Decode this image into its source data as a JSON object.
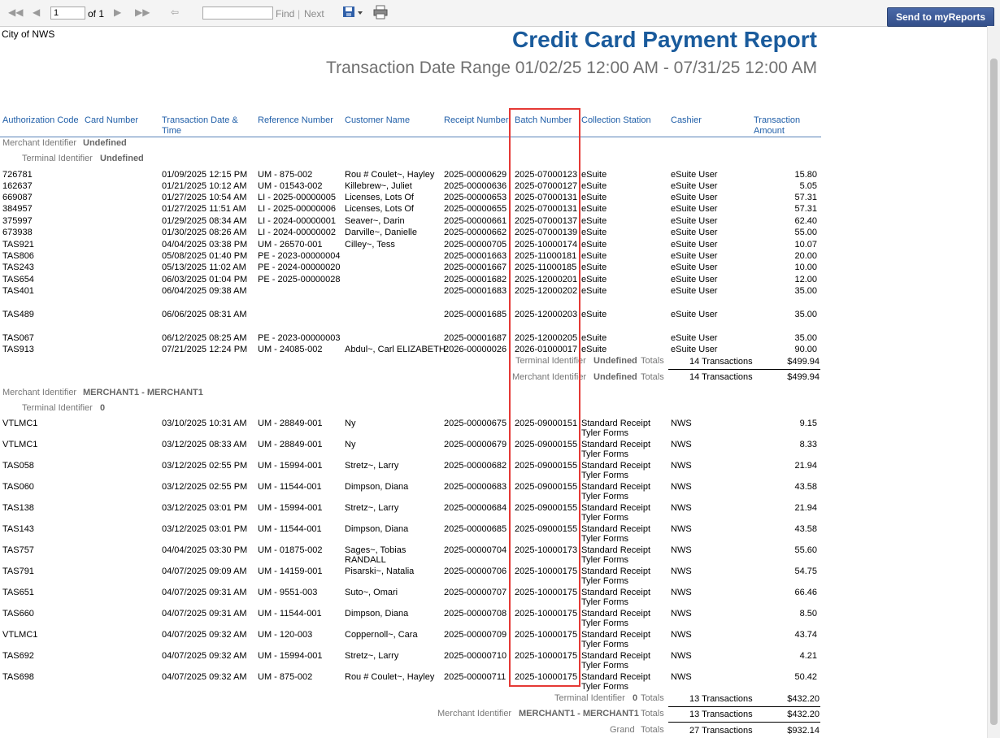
{
  "toolbar": {
    "first_icon": "first-page-icon",
    "prev_icon": "previous-page-icon",
    "page_value": "1",
    "of_label": "of 1",
    "next_icon": "next-page-icon",
    "last_icon": "last-page-icon",
    "back_icon": "back-icon",
    "find_value": "",
    "find_label": "Find",
    "separator": "|",
    "next_label": "Next",
    "export_icon": "save-export-icon",
    "print_icon": "printer-icon",
    "send_button": "Send to myReports"
  },
  "report": {
    "logo_alt": "City of NWS",
    "title": "Credit Card Payment Report",
    "subtitle": "Transaction Date Range 01/02/25 12:00 AM - 07/31/25 12:00 AM"
  },
  "headers": {
    "auth": "Authorization Code",
    "card": "Card Number",
    "date_l1": "Transaction Date &",
    "date_l2": "Time",
    "ref": "Reference Number",
    "customer": "Customer Name",
    "receipt": "Receipt Number",
    "batch": "Batch Number",
    "station": "Collection Station",
    "cashier": "Cashier",
    "amount_l1": "Transaction",
    "amount_l2": "Amount"
  },
  "labels": {
    "merchant_identifier": "Merchant Identifier",
    "terminal_identifier": "Terminal Identifier",
    "totals": "Totals",
    "grand": "Grand"
  },
  "groups": [
    {
      "merchant": "Undefined",
      "terminal": "Undefined",
      "rows": [
        {
          "auth": "726781",
          "date": "01/09/2025 12:15 PM",
          "ref": "UM - 875-002",
          "customer": "Rou # Coulet~, Hayley",
          "receipt": "2025-00000629",
          "batch": "2025-07000123",
          "station": "eSuite",
          "station2": "",
          "cashier": "eSuite User",
          "amount": "15.80",
          "customer2": ""
        },
        {
          "auth": "162637",
          "date": "01/21/2025 10:12 AM",
          "ref": "UM - 01543-002",
          "customer": "Killebrew~, Juliet",
          "receipt": "2025-00000636",
          "batch": "2025-07000127",
          "station": "eSuite",
          "station2": "",
          "cashier": "eSuite User",
          "amount": "5.05",
          "customer2": ""
        },
        {
          "auth": "669087",
          "date": "01/27/2025 10:54 AM",
          "ref": "LI - 2025-00000005",
          "customer": "Licenses, Lots Of",
          "receipt": "2025-00000653",
          "batch": "2025-07000131",
          "station": "eSuite",
          "station2": "",
          "cashier": "eSuite User",
          "amount": "57.31",
          "customer2": ""
        },
        {
          "auth": "384957",
          "date": "01/27/2025 11:51 AM",
          "ref": "LI - 2025-00000006",
          "customer": "Licenses, Lots Of",
          "receipt": "2025-00000655",
          "batch": "2025-07000131",
          "station": "eSuite",
          "station2": "",
          "cashier": "eSuite User",
          "amount": "57.31",
          "customer2": ""
        },
        {
          "auth": "375997",
          "date": "01/29/2025 08:34 AM",
          "ref": "LI - 2024-00000001",
          "customer": "Seaver~, Darin",
          "receipt": "2025-00000661",
          "batch": "2025-07000137",
          "station": "eSuite",
          "station2": "",
          "cashier": "eSuite User",
          "amount": "62.40",
          "customer2": ""
        },
        {
          "auth": "673938",
          "date": "01/30/2025 08:26 AM",
          "ref": "LI - 2024-00000002",
          "customer": "Darville~, Danielle",
          "receipt": "2025-00000662",
          "batch": "2025-07000139",
          "station": "eSuite",
          "station2": "",
          "cashier": "eSuite User",
          "amount": "55.00",
          "customer2": ""
        },
        {
          "auth": "TAS921",
          "date": "04/04/2025 03:38 PM",
          "ref": "UM - 26570-001",
          "customer": "Cilley~, Tess",
          "receipt": "2025-00000705",
          "batch": "2025-10000174",
          "station": "eSuite",
          "station2": "",
          "cashier": "eSuite User",
          "amount": "10.07",
          "customer2": ""
        },
        {
          "auth": "TAS806",
          "date": "05/08/2025 01:40 PM",
          "ref": "PE - 2023-00000004",
          "customer": "",
          "receipt": "2025-00001663",
          "batch": "2025-11000181",
          "station": "eSuite",
          "station2": "",
          "cashier": "eSuite User",
          "amount": "20.00",
          "customer2": ""
        },
        {
          "auth": "TAS243",
          "date": "05/13/2025 11:02 AM",
          "ref": "PE - 2024-00000020",
          "customer": "",
          "receipt": "2025-00001667",
          "batch": "2025-11000185",
          "station": "eSuite",
          "station2": "",
          "cashier": "eSuite User",
          "amount": "10.00",
          "customer2": ""
        },
        {
          "auth": "TAS654",
          "date": "06/03/2025 01:04 PM",
          "ref": "PE - 2025-00000028",
          "customer": "",
          "receipt": "2025-00001682",
          "batch": "2025-12000201",
          "station": "eSuite",
          "station2": "",
          "cashier": "eSuite User",
          "amount": "12.00",
          "customer2": ""
        },
        {
          "auth": "TAS401",
          "date": "06/04/2025 09:38 AM",
          "ref": "",
          "customer": "",
          "receipt": "2025-00001683",
          "batch": "2025-12000202",
          "station": "eSuite",
          "station2": "",
          "cashier": "eSuite User",
          "amount": "35.00",
          "customer2": ""
        },
        {
          "auth": "TAS489",
          "date": "06/06/2025 08:31 AM",
          "ref": "",
          "customer": "",
          "receipt": "2025-00001685",
          "batch": "2025-12000203",
          "station": "eSuite",
          "station2": "",
          "cashier": "eSuite User",
          "amount": "35.00",
          "customer2": ""
        },
        {
          "auth": "TAS067",
          "date": "06/12/2025 08:25 AM",
          "ref": "PE - 2023-00000003",
          "customer": "",
          "receipt": "2025-00001687",
          "batch": "2025-12000205",
          "station": "eSuite",
          "station2": "",
          "cashier": "eSuite User",
          "amount": "35.00",
          "customer2": ""
        },
        {
          "auth": "TAS913",
          "date": "07/21/2025 12:24 PM",
          "ref": "UM - 24085-002",
          "customer": "Abdul~, Carl ELIZABETH",
          "receipt": "2026-00000026",
          "batch": "2026-01000017",
          "station": "eSuite",
          "station2": "",
          "cashier": "eSuite User",
          "amount": "90.00",
          "customer2": ""
        }
      ],
      "terminal_total_count": "14 Transactions",
      "terminal_total_amount": "$499.94",
      "merchant_total_count": "14 Transactions",
      "merchant_total_amount": "$499.94"
    },
    {
      "merchant": "MERCHANT1 - MERCHANT1",
      "terminal": "0",
      "rows": [
        {
          "auth": "VTLMC1",
          "date": "03/10/2025 10:31 AM",
          "ref": "UM - 28849-001",
          "customer": "Ny",
          "receipt": "2025-00000675",
          "batch": "2025-09000151",
          "station": "Standard Receipt",
          "station2": "Tyler Forms",
          "cashier": "NWS",
          "amount": "9.15",
          "customer2": ""
        },
        {
          "auth": "VTLMC1",
          "date": "03/12/2025 08:33 AM",
          "ref": "UM - 28849-001",
          "customer": "Ny",
          "receipt": "2025-00000679",
          "batch": "2025-09000155",
          "station": "Standard Receipt",
          "station2": "Tyler Forms",
          "cashier": "NWS",
          "amount": "8.33",
          "customer2": ""
        },
        {
          "auth": "TAS058",
          "date": "03/12/2025 02:55 PM",
          "ref": "UM - 15994-001",
          "customer": "Stretz~, Larry",
          "receipt": "2025-00000682",
          "batch": "2025-09000155",
          "station": "Standard Receipt",
          "station2": "Tyler Forms",
          "cashier": "NWS",
          "amount": "21.94",
          "customer2": ""
        },
        {
          "auth": "TAS060",
          "date": "03/12/2025 02:55 PM",
          "ref": "UM - 11544-001",
          "customer": "Dimpson, Diana",
          "receipt": "2025-00000683",
          "batch": "2025-09000155",
          "station": "Standard Receipt",
          "station2": "Tyler Forms",
          "cashier": "NWS",
          "amount": "43.58",
          "customer2": ""
        },
        {
          "auth": "TAS138",
          "date": "03/12/2025 03:01 PM",
          "ref": "UM - 15994-001",
          "customer": "Stretz~, Larry",
          "receipt": "2025-00000684",
          "batch": "2025-09000155",
          "station": "Standard Receipt",
          "station2": "Tyler Forms",
          "cashier": "NWS",
          "amount": "21.94",
          "customer2": ""
        },
        {
          "auth": "TAS143",
          "date": "03/12/2025 03:01 PM",
          "ref": "UM - 11544-001",
          "customer": "Dimpson, Diana",
          "receipt": "2025-00000685",
          "batch": "2025-09000155",
          "station": "Standard Receipt",
          "station2": "Tyler Forms",
          "cashier": "NWS",
          "amount": "43.58",
          "customer2": ""
        },
        {
          "auth": "TAS757",
          "date": "04/04/2025 03:30 PM",
          "ref": "UM - 01875-002",
          "customer": "Sages~, Tobias",
          "receipt": "2025-00000704",
          "batch": "2025-10000173",
          "station": "Standard Receipt",
          "station2": "Tyler Forms",
          "cashier": "NWS",
          "amount": "55.60",
          "customer2": "RANDALL"
        },
        {
          "auth": "TAS791",
          "date": "04/07/2025 09:09 AM",
          "ref": "UM - 14159-001",
          "customer": "Pisarski~, Natalia",
          "receipt": "2025-00000706",
          "batch": "2025-10000175",
          "station": "Standard Receipt",
          "station2": "Tyler Forms",
          "cashier": "NWS",
          "amount": "54.75",
          "customer2": ""
        },
        {
          "auth": "TAS651",
          "date": "04/07/2025 09:31 AM",
          "ref": "UM - 9551-003",
          "customer": "Suto~, Omari",
          "receipt": "2025-00000707",
          "batch": "2025-10000175",
          "station": "Standard Receipt",
          "station2": "Tyler Forms",
          "cashier": "NWS",
          "amount": "66.46",
          "customer2": ""
        },
        {
          "auth": "TAS660",
          "date": "04/07/2025 09:31 AM",
          "ref": "UM - 11544-001",
          "customer": "Dimpson, Diana",
          "receipt": "2025-00000708",
          "batch": "2025-10000175",
          "station": "Standard Receipt",
          "station2": "Tyler Forms",
          "cashier": "NWS",
          "amount": "8.50",
          "customer2": ""
        },
        {
          "auth": "VTLMC1",
          "date": "04/07/2025 09:32 AM",
          "ref": "UM - 120-003",
          "customer": "Coppernoll~, Cara",
          "receipt": "2025-00000709",
          "batch": "2025-10000175",
          "station": "Standard Receipt",
          "station2": "Tyler Forms",
          "cashier": "NWS",
          "amount": "43.74",
          "customer2": ""
        },
        {
          "auth": "TAS692",
          "date": "04/07/2025 09:32 AM",
          "ref": "UM - 15994-001",
          "customer": "Stretz~, Larry",
          "receipt": "2025-00000710",
          "batch": "2025-10000175",
          "station": "Standard Receipt",
          "station2": "Tyler Forms",
          "cashier": "NWS",
          "amount": "4.21",
          "customer2": ""
        },
        {
          "auth": "TAS698",
          "date": "04/07/2025 09:32 AM",
          "ref": "UM - 875-002",
          "customer": "Rou # Coulet~, Hayley",
          "receipt": "2025-00000711",
          "batch": "2025-10000175",
          "station": "Standard Receipt",
          "station2": "Tyler Forms",
          "cashier": "NWS",
          "amount": "50.42",
          "customer2": ""
        }
      ],
      "terminal_total_count": "13 Transactions",
      "terminal_total_amount": "$432.20",
      "merchant_total_count": "13 Transactions",
      "merchant_total_amount": "$432.20"
    }
  ],
  "grand_total_count": "27 Transactions",
  "grand_total_amount": "$932.14",
  "colors": {
    "title": "#1a5b9c",
    "header_text": "#1f5ea8",
    "highlight_box": "#e53935",
    "send_button": "#3b5998"
  }
}
